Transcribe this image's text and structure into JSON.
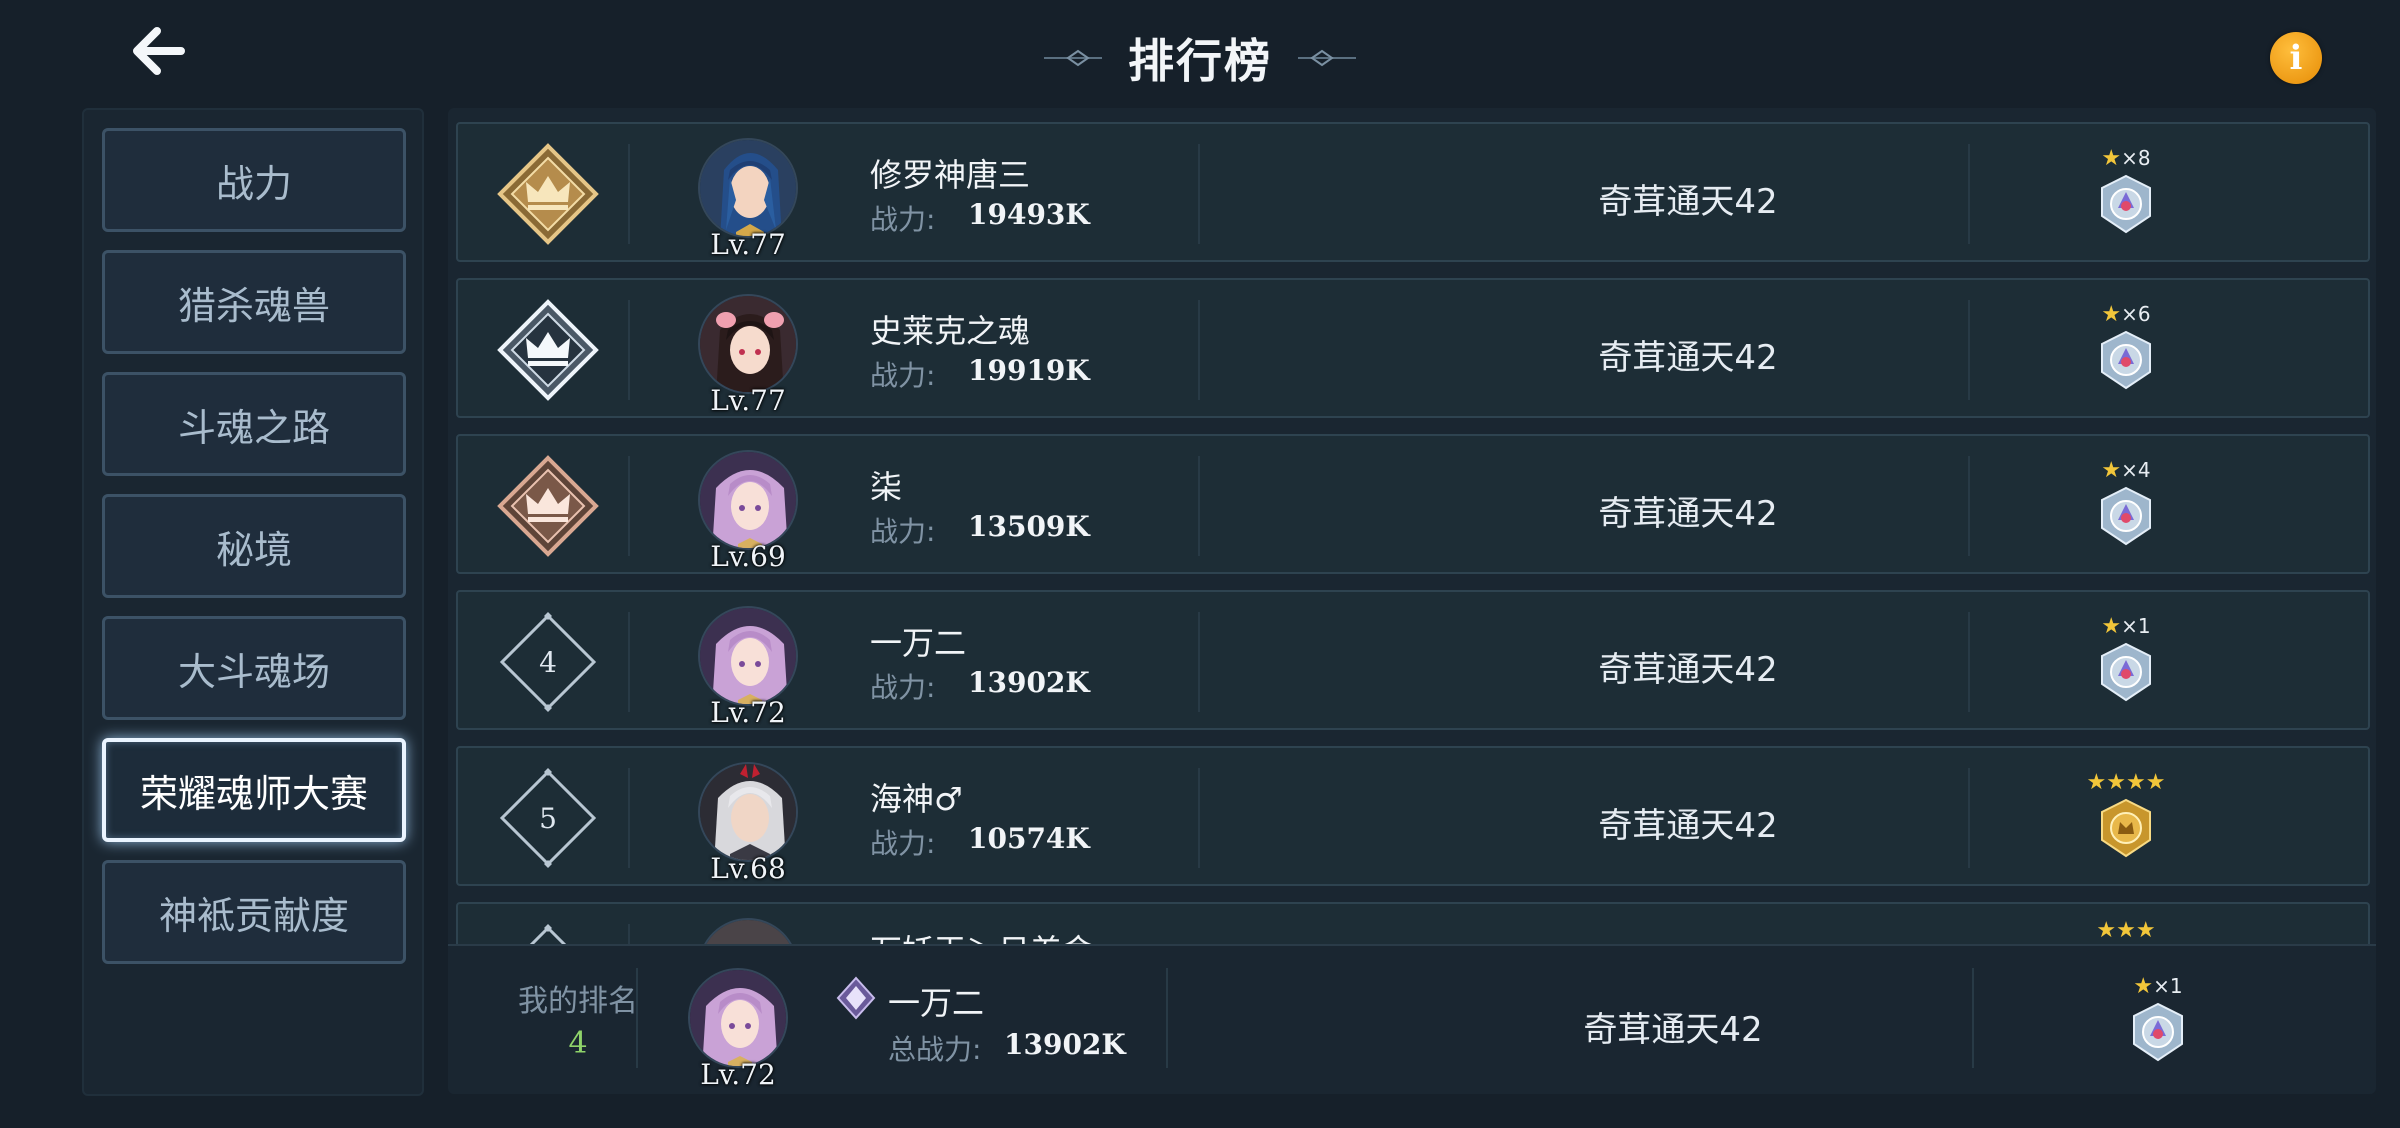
{
  "header": {
    "title": "排行榜",
    "back_icon": "arrow-left-icon",
    "info_icon": "info-icon",
    "info_glyph": "i",
    "info_color": "#f29a12"
  },
  "sidebar": {
    "active_index": 5,
    "items": [
      {
        "label": "战力"
      },
      {
        "label": "猎杀魂兽"
      },
      {
        "label": "斗魂之路"
      },
      {
        "label": "秘境"
      },
      {
        "label": "大斗魂场"
      },
      {
        "label": "荣耀魂师大赛"
      },
      {
        "label": "神袛贡献度"
      }
    ]
  },
  "rows": [
    {
      "rank": "1",
      "rank_style": "gold-crown",
      "level": "Lv.77",
      "name": "修罗神唐三",
      "power_label": "战力:",
      "power": "19493K",
      "server": "奇茸通天42",
      "honor_stars": "★",
      "honor_mult": "×8",
      "medal": "silver"
    },
    {
      "rank": "2",
      "rank_style": "silver-crown",
      "level": "Lv.77",
      "name": "史莱克之魂",
      "power_label": "战力:",
      "power": "19919K",
      "server": "奇茸通天42",
      "honor_stars": "★",
      "honor_mult": "×6",
      "medal": "silver"
    },
    {
      "rank": "3",
      "rank_style": "bronze-crown",
      "level": "Lv.69",
      "name": "柒",
      "power_label": "战力:",
      "power": "13509K",
      "server": "奇茸通天42",
      "honor_stars": "★",
      "honor_mult": "×4",
      "medal": "silver"
    },
    {
      "rank": "4",
      "rank_style": "plain",
      "level": "Lv.72",
      "name": "一万二",
      "power_label": "战力:",
      "power": "13902K",
      "server": "奇茸通天42",
      "honor_stars": "★",
      "honor_mult": "×1",
      "medal": "silver"
    },
    {
      "rank": "5",
      "rank_style": "plain",
      "level": "Lv.68",
      "name": "海神♂",
      "power_label": "战力:",
      "power": "10574K",
      "server": "奇茸通天42",
      "honor_stars": "★★★★",
      "honor_mult": "",
      "medal": "gold"
    },
    {
      "rank": "",
      "rank_style": "plain",
      "level": "",
      "name": "万妖王＞日差命",
      "power_label": "",
      "power": "",
      "server": "",
      "honor_stars": "★★★",
      "honor_mult": "",
      "medal": "none"
    }
  ],
  "my_rank": {
    "label": "我的排名",
    "rank": "4",
    "level": "Lv.72",
    "name": "一万二",
    "power_label": "总战力:",
    "power": "13902K",
    "server": "奇茸通天42",
    "honor_stars": "★",
    "honor_mult": "×1",
    "medal": "silver"
  },
  "colors": {
    "background": "#16202a",
    "row_bg": "#1d2d36",
    "active_glow": "#eaf4ff",
    "gold": "#c9a35a",
    "rank_highlight": "#8fd36a"
  }
}
